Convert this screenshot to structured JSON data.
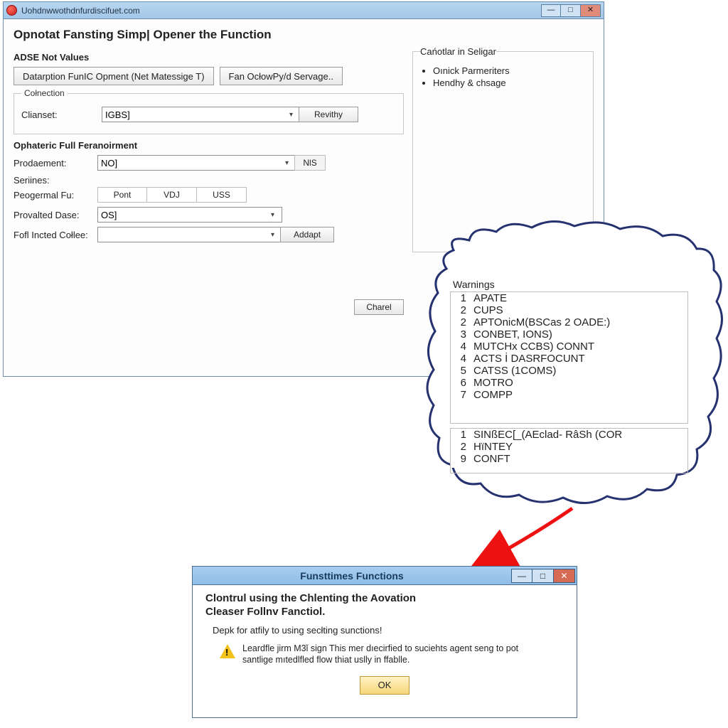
{
  "main": {
    "title": "Uohdnwwothdnfurdiscifuet.com",
    "heading": "Opnotat Fansting Simp| Opener the Function",
    "adse_section": "ADSE Not Values",
    "btn_datarption": "Datarption FunIC Opment (Net Matessige T)",
    "btn_fanoctow": "Fan OcłowPy/d Servage..",
    "group_colnection": "Cołnection",
    "label_clianset": "Clianset:",
    "clianset_value": "IGBS]",
    "btn_revithy": "Revithy",
    "group_ophateric": "Ophateric Full Feranoirment",
    "label_prodaement": "Prodaement:",
    "prodaement_value": "NO]",
    "btn_nis": "NlS",
    "label_seriines": "Seriines:",
    "label_peogermal": "Peogermal Fu:",
    "seg_pont": "Pont",
    "seg_vdj": "VDJ",
    "seg_uss": "USS",
    "label_provalted": "Provalted Dase:",
    "provalted_value": "OS]",
    "label_fofl": "Fofl Incted Cołlee:",
    "fofl_value": "",
    "btn_addapt": "Addapt",
    "btn_charel": "Charel"
  },
  "side": {
    "title": "Cańotlar in Seligar",
    "items": [
      "Oınick Parmeriters",
      "Hendhy & chsage"
    ]
  },
  "warnings": {
    "title": "Warnings",
    "listA": [
      {
        "n": "1",
        "t": "APATE"
      },
      {
        "n": "2",
        "t": "CUPS"
      },
      {
        "n": "2",
        "t": "APTOnicM(BSCas 2 OADE:)"
      },
      {
        "n": "3",
        "t": "CONBET, IONS)"
      },
      {
        "n": "4",
        "t": "MUTCHx CCBS) CONNT"
      },
      {
        "n": "4",
        "t": "ACTS İ DASRFOCUNT"
      },
      {
        "n": "5",
        "t": "CATSS (1COMS)"
      },
      {
        "n": "6",
        "t": "MOTRO"
      },
      {
        "n": "7",
        "t": "COMPP"
      }
    ],
    "listB": [
      {
        "n": "1",
        "t": "SINßEC[_(AEclad- RâSh (COR"
      },
      {
        "n": "2",
        "t": "HïNTEY"
      },
      {
        "n": "9",
        "t": "CONFT"
      }
    ]
  },
  "dialog": {
    "title": "Funsttimes Functions",
    "h1": "Clontrul using the Chlenting the Aovation",
    "h2": "Cleaser Follnv Fanctiol.",
    "line1": "Depk for atfily to using secłting sunctions!",
    "warn": "Leardfle jirm M3ǐ sign This mer dıecirfied to suciehts agent seng to pot santlige mıtedlfled flow thiat uslly in ffablle.",
    "ok": "OK"
  }
}
